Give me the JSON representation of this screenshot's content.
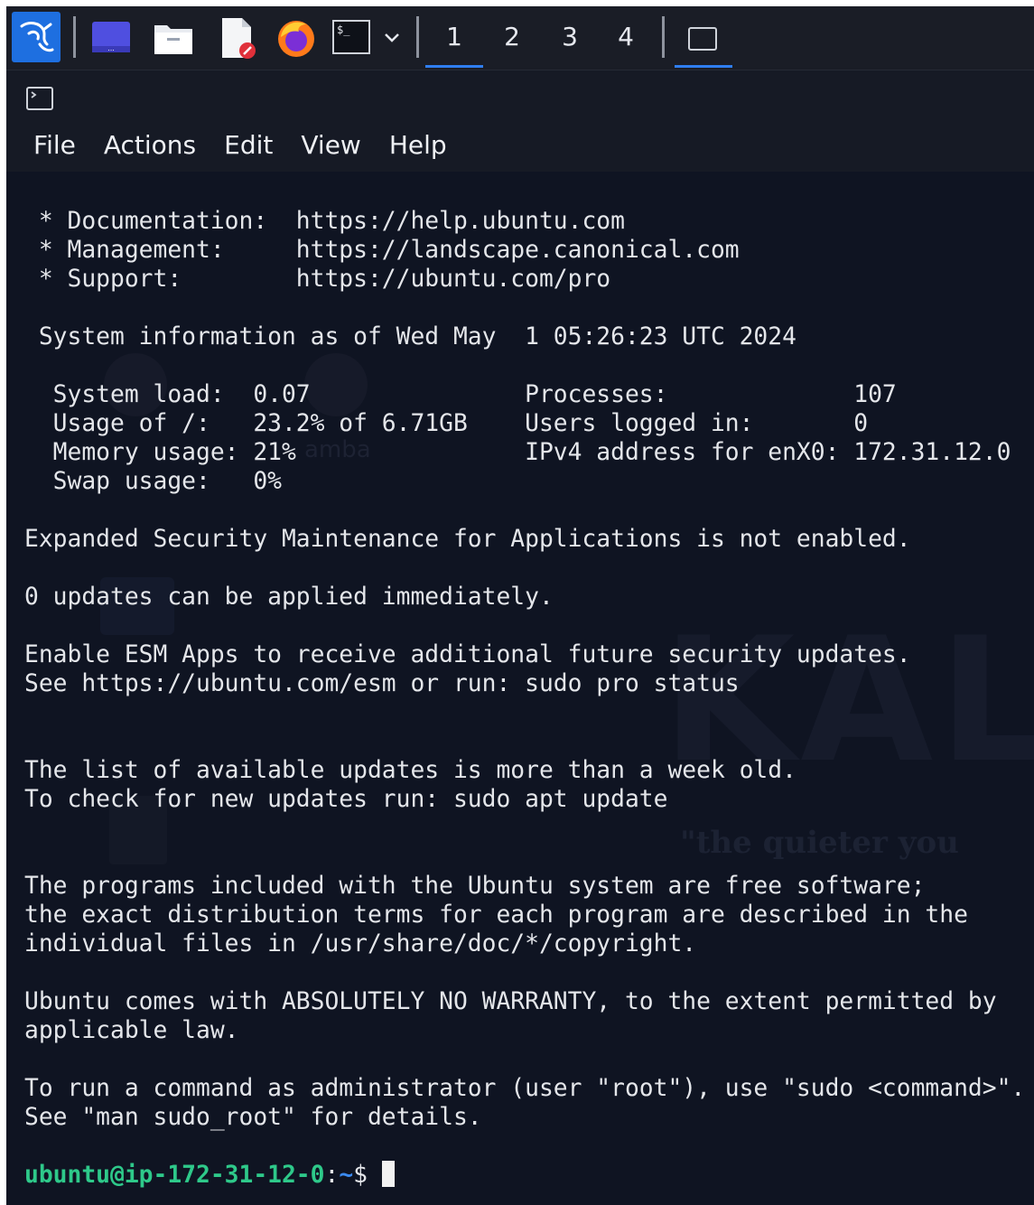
{
  "taskbar": {
    "apps": [
      {
        "name": "kali-menu-icon"
      },
      {
        "name": "desktop-icon"
      },
      {
        "name": "file-manager-icon"
      },
      {
        "name": "text-editor-icon"
      },
      {
        "name": "firefox-icon"
      },
      {
        "name": "terminal-icon"
      }
    ],
    "terminal_glyph": "$_",
    "workspaces": [
      "1",
      "2",
      "3",
      "4"
    ],
    "active_workspace": "1",
    "colors": {
      "accent": "#2f7ef0",
      "bar_bg": "#1a1d26"
    }
  },
  "window": {
    "menu": [
      "File",
      "Actions",
      "Edit",
      "View",
      "Help"
    ]
  },
  "watermark": {
    "brand": "KALI",
    "tagline": "\"the quieter you",
    "samba": "amba"
  },
  "terminal": {
    "lines": [
      " * Documentation:  https://help.ubuntu.com",
      " * Management:     https://landscape.canonical.com",
      " * Support:        https://ubuntu.com/pro",
      "",
      " System information as of Wed May  1 05:26:23 UTC 2024",
      "",
      "  System load:  0.07               Processes:             107",
      "  Usage of /:   23.2% of 6.71GB    Users logged in:       0",
      "  Memory usage: 21%                IPv4 address for enX0: 172.31.12.0",
      "  Swap usage:   0%",
      "",
      "Expanded Security Maintenance for Applications is not enabled.",
      "",
      "0 updates can be applied immediately.",
      "",
      "Enable ESM Apps to receive additional future security updates.",
      "See https://ubuntu.com/esm or run: sudo pro status",
      "",
      "",
      "The list of available updates is more than a week old.",
      "To check for new updates run: sudo apt update",
      "",
      "",
      "The programs included with the Ubuntu system are free software;",
      "the exact distribution terms for each program are described in the",
      "individual files in /usr/share/doc/*/copyright.",
      "",
      "Ubuntu comes with ABSOLUTELY NO WARRANTY, to the extent permitted by",
      "applicable law.",
      "",
      "To run a command as administrator (user \"root\"), use \"sudo <command>\".",
      "See \"man sudo_root\" for details.",
      ""
    ],
    "prompt": {
      "user_host": "ubuntu@ip-172-31-12-0",
      "separator": ":",
      "path": "~",
      "symbol": "$ "
    },
    "colors": {
      "bg": "#0f1422",
      "text": "#e4e6ea",
      "user": "#2ec98a",
      "path": "#3b8af0"
    }
  }
}
